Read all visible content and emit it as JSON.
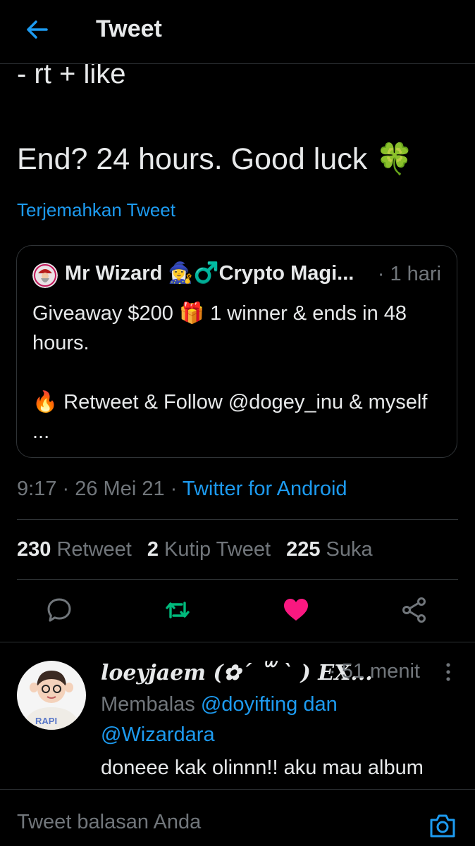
{
  "header": {
    "title": "Tweet",
    "back_icon": "arrow-left-icon"
  },
  "tweet": {
    "line_partial": "- rt + like",
    "line_end": "End? 24 hours. Good luck 🍀",
    "translate_link": "Terjemahkan Tweet",
    "time": "9:17",
    "date": "26 Mei 21",
    "source": "Twitter for Android",
    "stats": {
      "retweets_count": "230",
      "retweets_label": "Retweet",
      "quotes_count": "2",
      "quotes_label": "Kutip Tweet",
      "likes_count": "225",
      "likes_label": "Suka"
    }
  },
  "quote": {
    "name": "Mr Wizard 🧙‍♀️♂️Crypto Magi...",
    "time": "· 1 hari",
    "text_line1": "Giveaway $200 🎁 1 winner & ends in 48 hours.",
    "text_line2": "🔥 Retweet & Follow @dogey_inu & myself ..."
  },
  "actions": {
    "reply_icon": "comment-icon",
    "retweet_icon": "retweet-icon",
    "like_icon": "heart-icon",
    "share_icon": "share-icon",
    "retweet_color": "#00ba7c",
    "like_color": "#f91880"
  },
  "reply": {
    "name": "loeyjaem (✿´ ꒳ ` ) EX...",
    "time": "· 51 menit",
    "replying_prefix": "Membalas",
    "mention1": "@doyifting",
    "joiner": "dan",
    "mention2": "@Wizardara",
    "text": "doneee kak olinnn!! aku mau album"
  },
  "composer": {
    "placeholder": "Tweet balasan Anda",
    "camera_icon": "camera-icon"
  },
  "colors": {
    "accent": "#1d9bf0",
    "background": "#000000",
    "secondary_text": "#71767b"
  }
}
